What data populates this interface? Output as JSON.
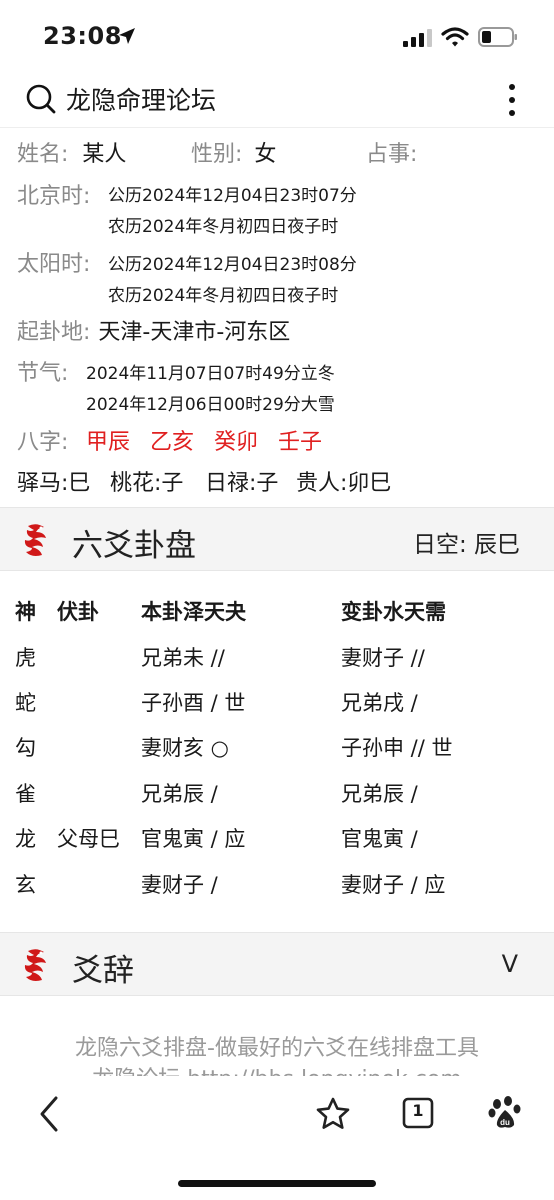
{
  "status_bar": {
    "time": "23:08"
  },
  "header": {
    "title": "龙隐命理论坛"
  },
  "info": {
    "name_label": "姓名:",
    "name_value": "某人",
    "gender_label": "性别:",
    "gender_value": "女",
    "matter_label": "占事:",
    "beijing_label": "北京时:",
    "beijing_solar": "公历2024年12月04日23时07分",
    "beijing_lunar": "农历2024年冬月初四日夜子时",
    "solar_label": "太阳时:",
    "solar_solar": "公历2024年12月04日23时08分",
    "solar_lunar": "农历2024年冬月初四日夜子时",
    "place_label": "起卦地:",
    "place_value": "天津-天津市-河东区",
    "term_label": "节气:",
    "term_line1": "2024年11月07日07时49分立冬",
    "term_line2": "2024年12月06日00时29分大雪",
    "bazi_label": "八字:",
    "bazi": [
      "甲辰",
      "乙亥",
      "癸卯",
      "壬子"
    ],
    "shensha": [
      "驿马:巳",
      "桃花:子",
      "日禄:子",
      "贵人:卯巳"
    ]
  },
  "gua_section": {
    "title": "六爻卦盘",
    "xunkong": "日空:  辰巳",
    "headers": {
      "shen": "神",
      "fushen": "伏卦",
      "ben": "本卦泽天夬",
      "bian": "变卦水天需"
    },
    "rows": [
      {
        "shen": "虎",
        "fushen": "",
        "ben": "兄弟未 //",
        "bian": "妻财子 //"
      },
      {
        "shen": "蛇",
        "fushen": "",
        "ben": "子孙酉  /  世",
        "bian": "兄弟戌  /"
      },
      {
        "shen": "勾",
        "fushen": "",
        "ben": "妻财亥 ○",
        "bian": "子孙申 // 世"
      },
      {
        "shen": "雀",
        "fushen": "",
        "ben": "兄弟辰  /",
        "bian": "兄弟辰  /"
      },
      {
        "shen": "龙",
        "fushen": "父母巳",
        "ben": "官鬼寅  /  应",
        "bian": "官鬼寅  /"
      },
      {
        "shen": "玄",
        "fushen": "",
        "ben": "妻财子  /",
        "bian": "妻财子  /  应"
      }
    ]
  },
  "yaoci_section": {
    "title": "爻辞",
    "toggle": "V"
  },
  "footer": {
    "line1": "龙隐六爻排盘-做最好的六爻在线排盘工具",
    "line2": "龙隐论坛 http://bbs.longyinok.com"
  },
  "browser": {
    "tab_count": "1"
  },
  "colors": {
    "accent_red": "#e02020",
    "label_gray": "#8a8a8a"
  },
  "icons": [
    "location-arrow-icon",
    "signal-icon",
    "wifi-icon",
    "battery-icon",
    "search-icon",
    "more-dots-icon",
    "dragon-icon",
    "back-icon",
    "star-icon",
    "tabs-icon",
    "baidu-paw-icon"
  ]
}
